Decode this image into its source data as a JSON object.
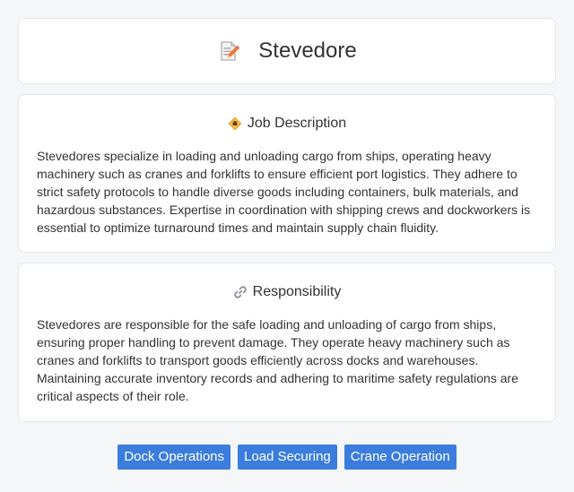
{
  "header": {
    "title": "Stevedore",
    "icon": "memo-pencil-icon"
  },
  "job_description": {
    "heading": "Job Description",
    "icon": "diamond-badge-icon",
    "text": "Stevedores specialize in loading and unloading cargo from ships, operating heavy machinery such as cranes and forklifts to ensure efficient port logistics. They adhere to strict safety protocols to handle diverse goods including containers, bulk materials, and hazardous substances. Expertise in coordination with shipping crews and dockworkers is essential to optimize turnaround times and maintain supply chain fluidity."
  },
  "responsibility": {
    "heading": "Responsibility",
    "icon": "link-icon",
    "text": "Stevedores are responsible for the safe loading and unloading of cargo from ships, ensuring proper handling to prevent damage. They operate heavy machinery such as cranes and forklifts to transport goods efficiently across docks and warehouses. Maintaining accurate inventory records and adhering to maritime safety regulations are critical aspects of their role."
  },
  "tags": [
    "Dock Operations",
    "Load Securing",
    "Crane Operation"
  ],
  "colors": {
    "background": "#f5f6f8",
    "card": "#ffffff",
    "tag": "#3b7ddd",
    "text": "#333333"
  }
}
